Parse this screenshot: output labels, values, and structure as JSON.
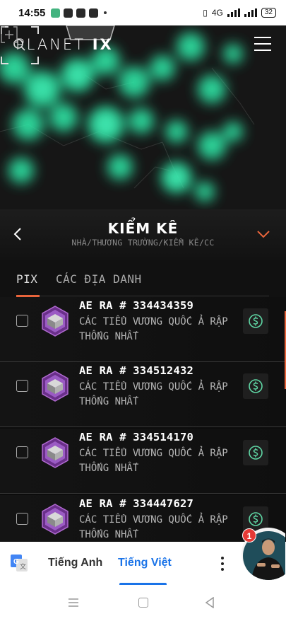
{
  "status_bar": {
    "time": "14:55",
    "network": "4G",
    "battery": "32"
  },
  "app": {
    "logo_text": "PLANET",
    "logo_suffix": "IX",
    "accent_color": "#e8643b",
    "map_glow_color": "#2ee6a6"
  },
  "header": {
    "title": "KIỂM KÊ",
    "breadcrumb": "NHÀ/THƯƠNG TRƯỜNG/KIỂM KÊ/CC"
  },
  "tabs": [
    {
      "label": "PIX",
      "active": true
    },
    {
      "label": "CÁC ĐỊA DANH",
      "active": false
    }
  ],
  "items": [
    {
      "title": "AE RA # 334434359",
      "subtitle": "CÁC TIỂU VƯƠNG QUỐC Ả RẬP THỐNG NHẤT"
    },
    {
      "title": "AE RA # 334512432",
      "subtitle": "CÁC TIỂU VƯƠNG QUỐC Ả RẬP THỐNG NHẤT"
    },
    {
      "title": "AE RA # 334514170",
      "subtitle": "CÁC TIỂU VƯƠNG QUỐC Ả RẬP THỐNG NHẤT"
    },
    {
      "title": "AE RA # 334447627",
      "subtitle": "CÁC TIỂU VƯƠNG QUỐC Ả RẬP THỐNG NHẤT"
    }
  ],
  "translate_bar": {
    "source_language": "Tiếng Anh",
    "target_language": "Tiếng Việt"
  },
  "chat_head": {
    "badge_count": "1"
  },
  "icons": {
    "menu": "hamburger-icon",
    "zoom": "magnifier-icon",
    "expand": "expand-icon",
    "back": "chevron-left-icon",
    "dropdown": "chevron-down-icon",
    "sell": "dollar-circle-icon",
    "translate": "google-translate-icon"
  }
}
